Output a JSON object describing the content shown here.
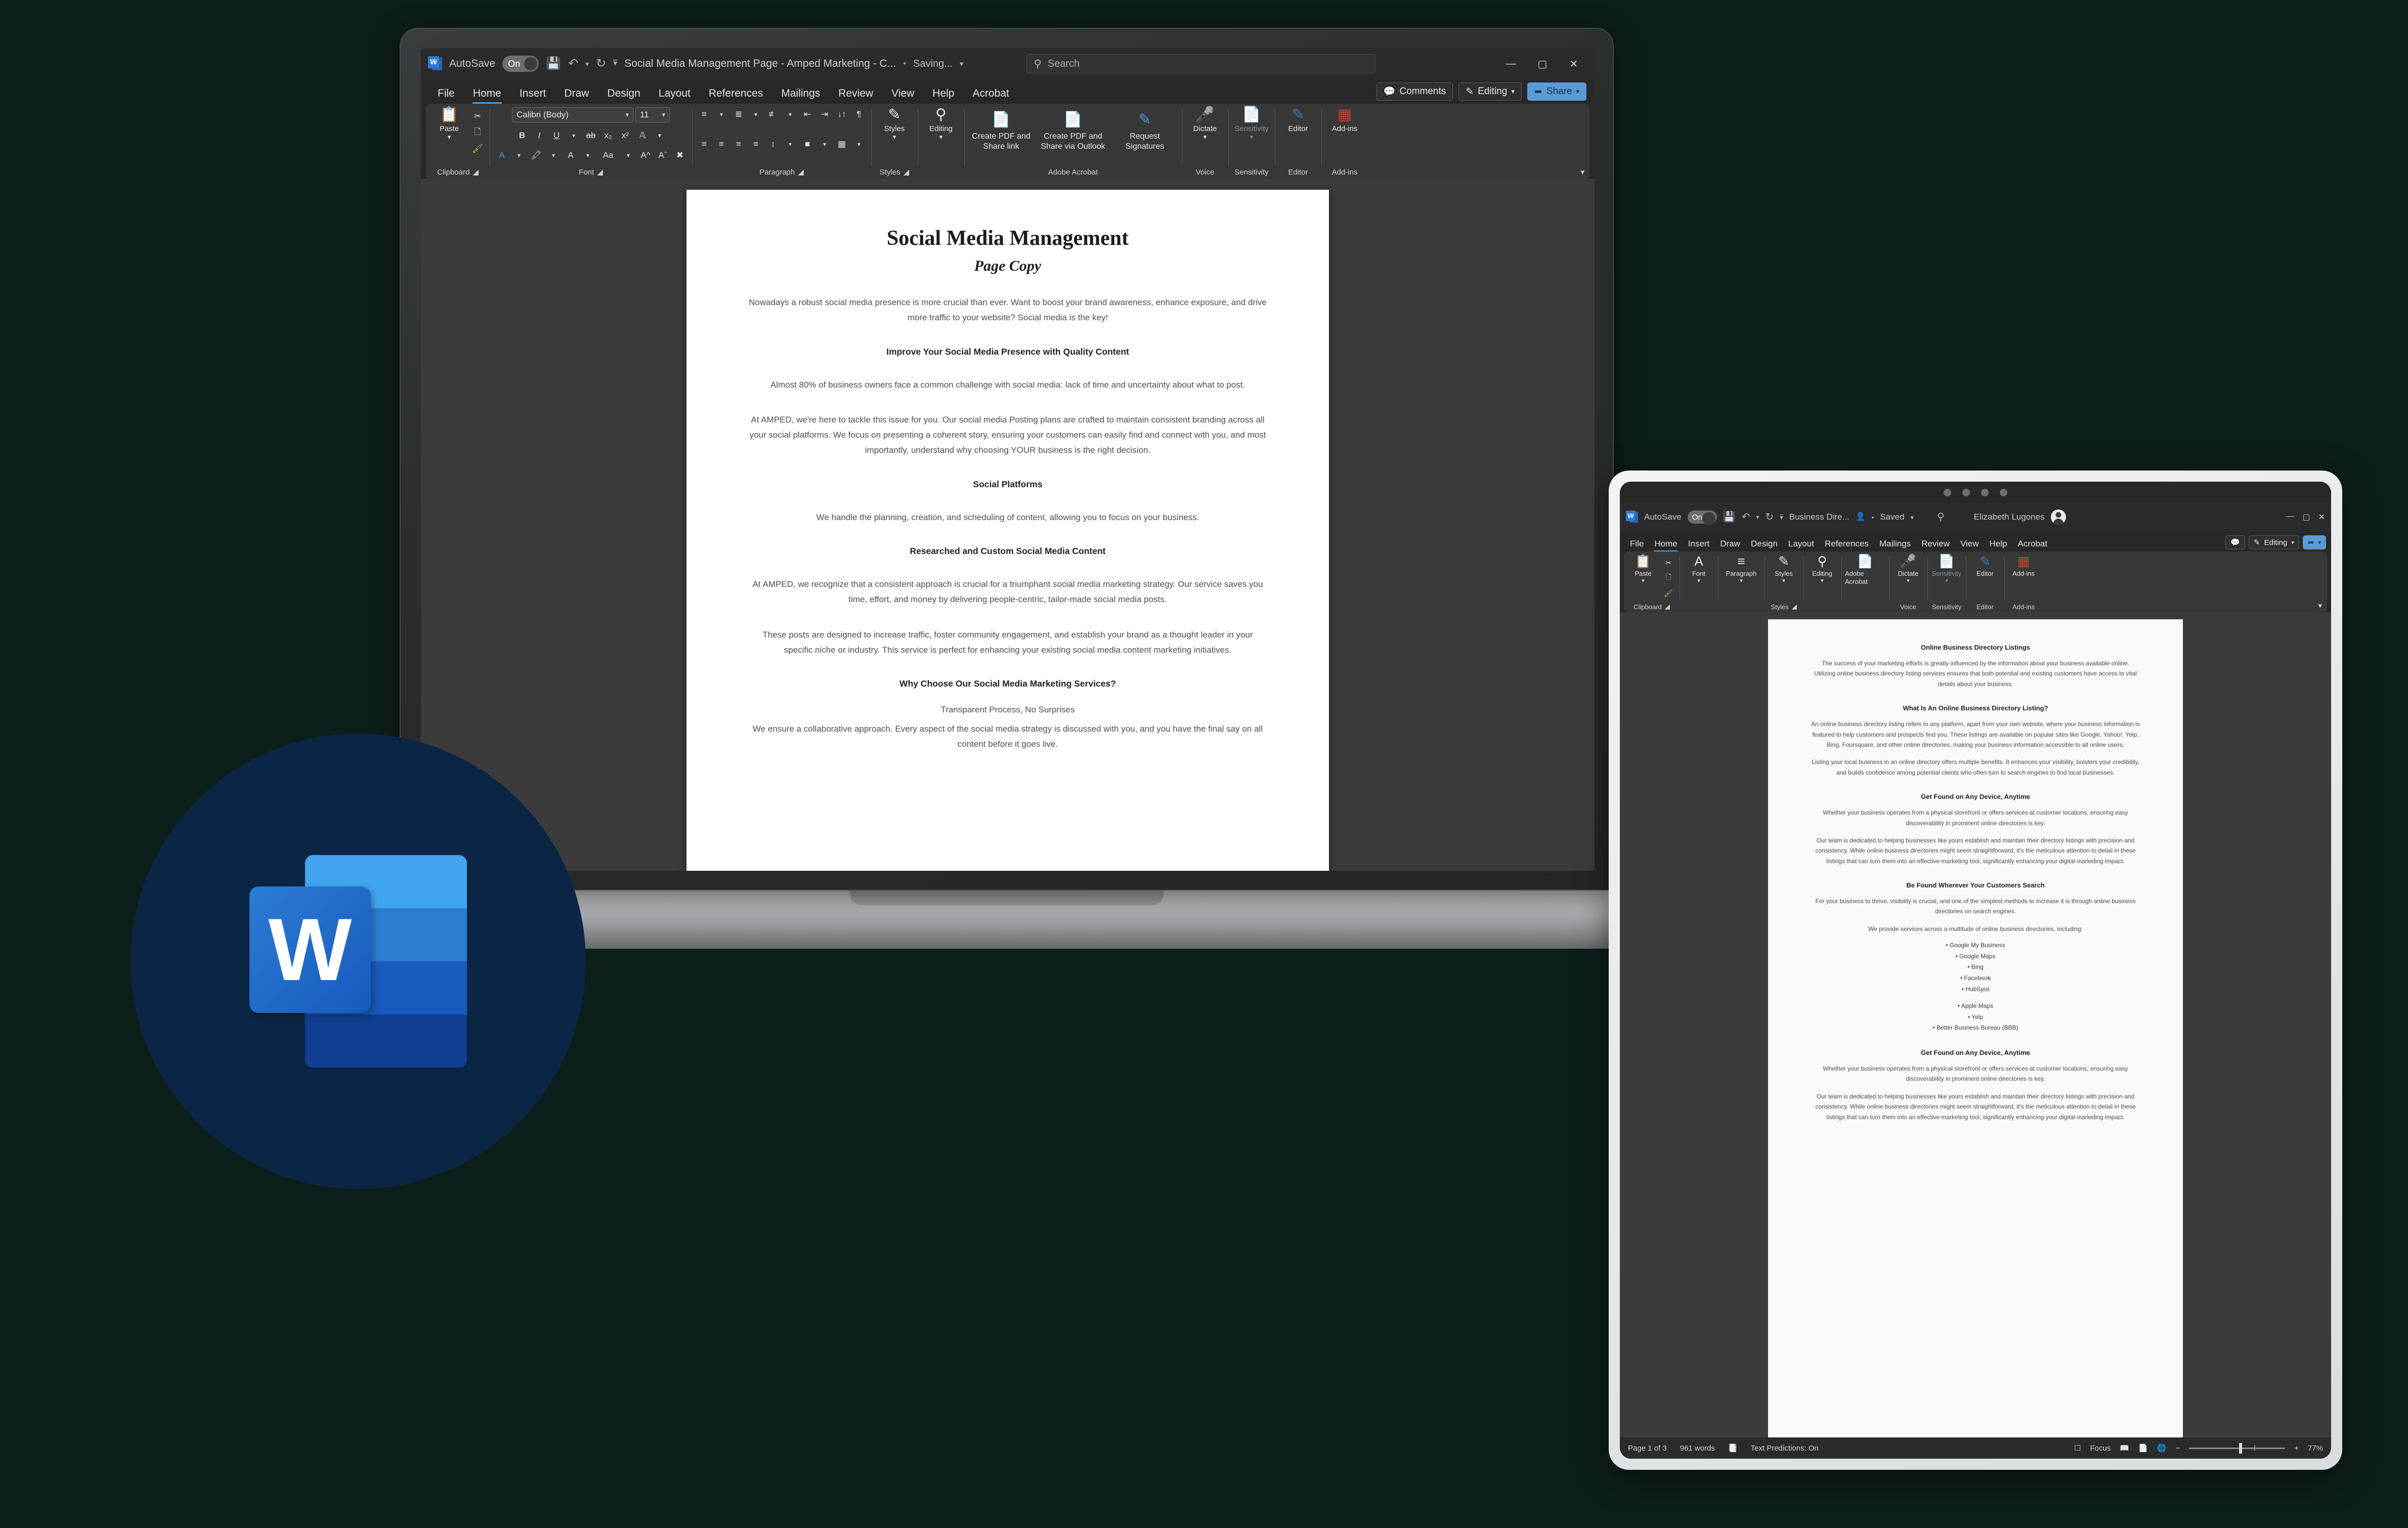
{
  "colors": {
    "accent": "#2b7cd3",
    "ribbon_bg": "#383838",
    "window_bg": "#282828",
    "share_blue": "#5b9bd5",
    "badge_navy": "#0b2545",
    "highlight_blue": "#4a9de0"
  },
  "desktop": {
    "titlebar": {
      "app_icon": "word-icon",
      "autosave_label": "AutoSave",
      "autosave_state": "On",
      "save_icon": "save-icon",
      "undo_icon": "undo-icon",
      "redo_icon": "redo-icon",
      "customize_icon": "customize-quick-access-icon",
      "doc_title": "Social Media Management Page - Amped Marketing - C...",
      "separator": "•",
      "save_status": "Saving...",
      "status_chevron": "chevron-down-icon",
      "minimize": "—",
      "maximize": "▢",
      "close": "✕"
    },
    "search": {
      "placeholder": "Search",
      "icon": "search-icon"
    },
    "tabs": [
      "File",
      "Home",
      "Insert",
      "Draw",
      "Design",
      "Layout",
      "References",
      "Mailings",
      "Review",
      "View",
      "Help",
      "Acrobat"
    ],
    "active_tab": "Home",
    "tab_actions": {
      "comments": "Comments",
      "editing": "Editing",
      "share": "Share"
    },
    "ribbon": {
      "clipboard": {
        "name": "Clipboard",
        "paste": "Paste",
        "cut_icon": "scissors-icon",
        "copy_icon": "copy-icon",
        "format_painter_icon": "format-painter-icon",
        "launcher_icon": "dialog-launcher-icon"
      },
      "font": {
        "name": "Font",
        "font_family": "Calibri (Body)",
        "font_size": "11",
        "bold": "B",
        "italic": "I",
        "underline": "U",
        "strikethrough": "ab",
        "subscript": "x₂",
        "superscript": "x²",
        "text_effects_icon": "text-effects-icon",
        "font_color_icon": "font-color-icon",
        "highlight_icon": "text-highlight-icon",
        "text_color_icon": "font-color-a-icon",
        "change_case": "Aa",
        "grow_font": "A^",
        "shrink_font": "A˅",
        "clear_formatting_icon": "clear-formatting-icon"
      },
      "paragraph": {
        "name": "Paragraph",
        "bullets_icon": "bullets-icon",
        "numbering_icon": "numbering-icon",
        "multilevel_icon": "multilevel-list-icon",
        "decrease_indent_icon": "decrease-indent-icon",
        "increase_indent_icon": "increase-indent-icon",
        "sort_icon": "sort-icon",
        "show_marks_icon": "show-paragraph-marks-icon",
        "align_left_icon": "align-left-icon",
        "align_center_icon": "align-center-icon",
        "align_right_icon": "align-right-icon",
        "justify_icon": "justify-icon",
        "line_spacing_icon": "line-spacing-icon",
        "shading_icon": "shading-icon",
        "borders_icon": "borders-icon"
      },
      "styles": {
        "name": "Styles",
        "label": "Styles",
        "icon": "styles-icon"
      },
      "editing": {
        "name": "Editing",
        "label": "Editing",
        "icon": "search-magnifier-icon"
      },
      "adobe": {
        "name": "Adobe Acrobat",
        "create_share_link": "Create PDF and Share link",
        "create_outlook": "Create PDF and Share via Outlook",
        "request_signatures": "Request Signatures"
      },
      "voice": {
        "name": "Voice",
        "label": "Dictate",
        "icon": "microphone-icon"
      },
      "sensitivity": {
        "name": "Sensitivity",
        "label": "Sensitivity",
        "icon": "sensitivity-icon"
      },
      "editor_group": {
        "name": "Editor",
        "label": "Editor",
        "icon": "editor-pen-icon"
      },
      "addins": {
        "name": "Add-ins",
        "label": "Add-ins",
        "icon": "add-ins-grid-icon"
      },
      "collapse_icon": "collapse-ribbon-icon"
    },
    "document": {
      "title": "Social Media Management",
      "subtitle": "Page Copy",
      "blocks": [
        {
          "type": "p",
          "text": "Nowadays a robust social media presence is more crucial than ever. Want to boost your brand awareness, enhance exposure, and drive more traffic to your website? Social media is the key!"
        },
        {
          "type": "h2",
          "text": "Improve Your Social Media Presence with Quality Content"
        },
        {
          "type": "p",
          "text": "Almost 80% of business owners face a common challenge with social media: lack of time and uncertainty about what to post."
        },
        {
          "type": "p",
          "text": "At AMPED, we're here to tackle this issue for you. Our social media Posting plans are crafted to maintain consistent branding across all your social platforms. We focus on presenting a coherent story, ensuring your customers can easily find and connect with you, and most importantly, understand why choosing YOUR business is the right decision."
        },
        {
          "type": "h2",
          "text": "Social Platforms"
        },
        {
          "type": "p",
          "text": "We handle the planning, creation, and scheduling of content, allowing you to focus on your business."
        },
        {
          "type": "h2",
          "text": "Researched and Custom Social Media Content"
        },
        {
          "type": "p",
          "text": "At AMPED, we recognize that a consistent approach is crucial for a triumphant social media marketing strategy. Our service saves you time, effort, and money by delivering people-centric, tailor-made social media posts."
        },
        {
          "type": "p",
          "text": "These posts are designed to increase traffic, foster community engagement, and establish your brand as a thought leader in your specific niche or industry. This service is perfect for enhancing your existing social media content marketing initiatives."
        },
        {
          "type": "h2",
          "text": "Why Choose Our Social Media Marketing Services?"
        },
        {
          "type": "p",
          "text": "Transparent Process, No Surprises"
        },
        {
          "type": "p",
          "text": "We ensure a collaborative approach. Every aspect of the social media strategy is discussed with you, and you have the final say on all content before it goes live."
        }
      ]
    }
  },
  "tablet": {
    "titlebar": {
      "app_icon": "word-icon",
      "autosave_label": "AutoSave",
      "autosave_state": "On",
      "save_icon": "save-icon",
      "undo_icon": "undo-icon",
      "redo_icon": "redo-icon",
      "customize_icon": "customize-quick-access-icon",
      "doc_title": "Business Dire...",
      "people_icon": "people-icon",
      "separator": "•",
      "save_status": "Saved",
      "status_chevron": "chevron-down-icon",
      "search_icon": "search-icon",
      "user_name": "Elizabeth Lugones",
      "avatar": "user-avatar",
      "minimize": "—",
      "maximize": "▢",
      "close": "✕"
    },
    "tabs": [
      "File",
      "Home",
      "Insert",
      "Draw",
      "Design",
      "Layout",
      "References",
      "Mailings",
      "Review",
      "View",
      "Help",
      "Acrobat"
    ],
    "active_tab": "Home",
    "tab_actions": {
      "comments_icon": "comments-icon",
      "editing": "Editing",
      "share_icon": "share-icon"
    },
    "ribbon": {
      "clipboard": {
        "name": "Clipboard",
        "paste": "Paste",
        "cut_icon": "scissors-icon",
        "copy_icon": "copy-icon",
        "format_painter_icon": "format-painter-icon",
        "launcher_icon": "dialog-launcher-icon"
      },
      "font": {
        "label": "Font",
        "icon": "font-a-icon"
      },
      "paragraph": {
        "label": "Paragraph",
        "icon": "paragraph-lines-icon"
      },
      "styles": {
        "name": "Styles",
        "label": "Styles",
        "icon": "styles-icon"
      },
      "editing": {
        "label": "Editing",
        "icon": "search-magnifier-icon"
      },
      "adobe": {
        "label": "Adobe Acrobat",
        "icon": "adobe-acrobat-icon"
      },
      "voice": {
        "name": "Voice",
        "label": "Dictate",
        "icon": "microphone-icon"
      },
      "sensitivity": {
        "name": "Sensitivity",
        "label": "Sensitivity",
        "icon": "sensitivity-icon"
      },
      "editor_group": {
        "name": "Editor",
        "label": "Editor",
        "icon": "editor-pen-icon"
      },
      "addins": {
        "name": "Add-ins",
        "label": "Add-ins",
        "icon": "add-ins-grid-icon"
      },
      "collapse_icon": "collapse-ribbon-icon"
    },
    "document": {
      "blocks": [
        {
          "type": "h2",
          "text": "Online Business Directory Listings"
        },
        {
          "type": "p",
          "text": "The success of your marketing efforts is greatly influenced by the information about your business available online. Utilizing online business directory listing services ensures that both potential and existing customers have access to vital details about your business."
        },
        {
          "type": "h2",
          "text": "What Is An Online Business Directory Listing?"
        },
        {
          "type": "p",
          "text": "An online business directory listing refers to any platform, apart from your own website, where your business information is featured to help customers and prospects find you. These listings are available on popular sites like Google, Yahoo!, Yelp, Bing, Foursquare, and other online directories, making your business information accessible to all online users."
        },
        {
          "type": "p",
          "text": "Listing your local business in an online directory offers multiple benefits. It enhances your visibility, bolsters your credibility, and builds confidence among potential clients who often turn to search engines to find local businesses."
        },
        {
          "type": "h2",
          "text": "Get Found on Any Device, Anytime"
        },
        {
          "type": "p",
          "text": "Whether your business operates from a physical storefront or offers services at customer locations, ensuring easy discoverability in prominent online directories is key."
        },
        {
          "type": "p",
          "text": "Our team is dedicated to helping businesses like yours establish and maintain their directory listings with precision and consistency. While online business directories might seem straightforward, it's the meticulous attention to detail in these listings that can turn them into an effective marketing tool, significantly enhancing your digital marketing impact."
        },
        {
          "type": "h2",
          "text": "Be Found Wherever Your Customers Search"
        },
        {
          "type": "p",
          "text": "For your business to thrive, visibility is crucial, and one of the simplest methods to increase it is through online business directories on search engines."
        },
        {
          "type": "p",
          "text": "We provide services across a multitude of online business directories, including:"
        },
        {
          "type": "ul",
          "items": [
            "Google My Business",
            "Google Maps",
            "Bing",
            "Facebook",
            "HubSpot"
          ]
        },
        {
          "type": "ul",
          "items": [
            "Apple Maps",
            "Yelp",
            "Better Business Bureau (BBB)"
          ]
        },
        {
          "type": "h2",
          "text": "Get Found on Any Device, Anytime"
        },
        {
          "type": "p",
          "text": "Whether your business operates from a physical storefront or offers services at customer locations, ensuring easy discoverability in prominent online directories is key."
        },
        {
          "type": "p",
          "text": "Our team is dedicated to helping businesses like yours establish and maintain their directory listings with precision and consistency. While online business directories might seem straightforward, it's the meticulous attention to detail in these listings that can turn them into an effective marketing tool, significantly enhancing your digital marketing impact."
        }
      ]
    },
    "status": {
      "page": "Page 1 of 3",
      "words": "961 words",
      "proofing_icon": "proofing-errors-icon",
      "text_predictions": "Text Predictions: On",
      "focus": "Focus",
      "focus_icon": "focus-icon",
      "read_mode_icon": "read-mode-icon",
      "print_layout_icon": "print-layout-icon",
      "web_layout_icon": "web-layout-icon",
      "zoom_out": "−",
      "zoom_in": "+",
      "zoom_level": "77%"
    }
  },
  "logo_badge": {
    "letter": "W",
    "name": "microsoft-word-logo"
  }
}
